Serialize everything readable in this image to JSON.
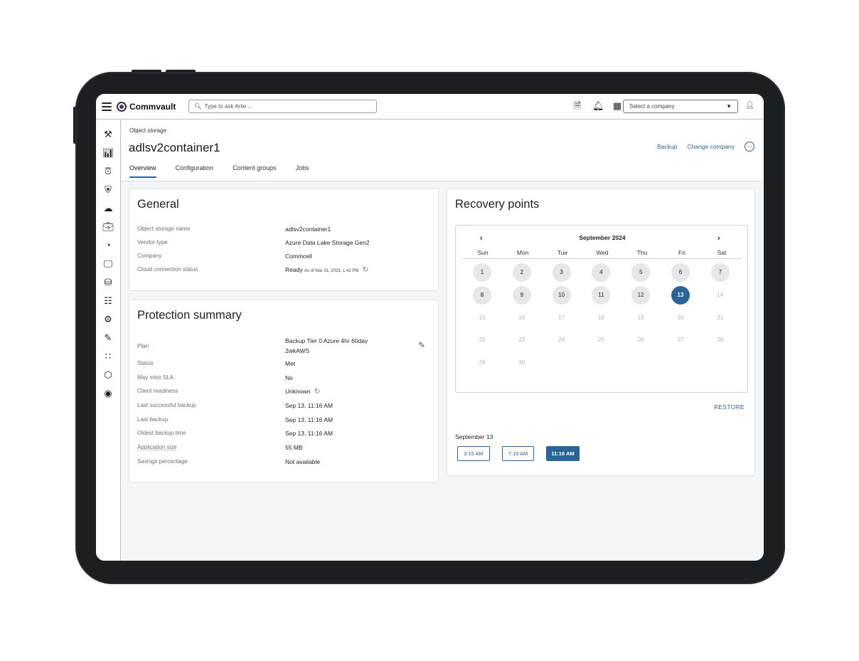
{
  "app": {
    "name": "Commvault"
  },
  "search": {
    "placeholder": "Type to ask Arlie ..."
  },
  "company_select": {
    "value": "Select a company"
  },
  "breadcrumb": "Object storage",
  "page_title": "adlsv2container1",
  "actions": {
    "backup": "Backup",
    "change_company": "Change company"
  },
  "tabs": [
    "Overview",
    "Configuration",
    "Content groups",
    "Jobs"
  ],
  "general": {
    "title": "General",
    "rows": [
      {
        "label": "Object storage name",
        "value": "adlsv2container1"
      },
      {
        "label": "Vendor type",
        "value": "Azure Data Lake Storage Gen2"
      },
      {
        "label": "Company",
        "value": "Commcell"
      },
      {
        "label": "Cloud connection status",
        "value": "Ready",
        "note": "As of Mar 31, 2023, 1:42 PM"
      }
    ]
  },
  "protection": {
    "title": "Protection summary",
    "plan_label": "Plan",
    "plan_value_line1": "Backup Tier 0 Azure 4hr 60day",
    "plan_value_line2": "2wkAWS",
    "rows": [
      {
        "label": "Status",
        "value": "Met"
      },
      {
        "label": "May miss SLA",
        "value": "No"
      },
      {
        "label": "Client readiness",
        "value": "Unknown"
      },
      {
        "label": "Last successful backup",
        "value": "Sep 13, 11:16 AM"
      },
      {
        "label": "Last backup",
        "value": "Sep 13, 11:16 AM"
      },
      {
        "label": "Oldest backup time",
        "value": "Sep 13, 11:16 AM"
      },
      {
        "label": "Application size",
        "value": "55 MB"
      },
      {
        "label": "Savings percentage",
        "value": "Not available"
      }
    ]
  },
  "recovery": {
    "title": "Recovery points",
    "month": "September 2024",
    "weekdays": [
      "Sun",
      "Mon",
      "Tue",
      "Wed",
      "Thu",
      "Fri",
      "Sat"
    ],
    "days": [
      "1",
      "2",
      "3",
      "4",
      "5",
      "6",
      "7",
      "8",
      "9",
      "10",
      "11",
      "12",
      "13",
      "14",
      "15",
      "16",
      "17",
      "18",
      "19",
      "20",
      "21",
      "22",
      "23",
      "24",
      "25",
      "26",
      "27",
      "28",
      "29",
      "30"
    ],
    "available_days": [
      "1",
      "2",
      "3",
      "4",
      "5",
      "6",
      "7",
      "8",
      "9",
      "10",
      "11",
      "12"
    ],
    "selected_day": "13",
    "restore": "RESTORE",
    "selected_date": "September 13",
    "times": [
      "3:15 AM",
      "7:16 AM",
      "11:16 AM"
    ],
    "selected_time": "11:16 AM"
  },
  "colors": {
    "accent": "#2b6597",
    "success": "#2b9a3e",
    "brand": "#5a2a82"
  },
  "icons": {
    "topbar": [
      "reports-icon",
      "bell-icon",
      "dashboard-icon",
      "user-icon"
    ],
    "leftnav": [
      "tools-icon",
      "analytics-icon",
      "alarm-icon",
      "shield-icon",
      "cloud-icon",
      "briefcase-icon",
      "gauge-icon",
      "monitor-icon",
      "database-icon",
      "sliders-icon",
      "settings-icon",
      "reports-edit-icon",
      "apps-grid-icon",
      "cube-icon",
      "commvault-icon"
    ]
  }
}
